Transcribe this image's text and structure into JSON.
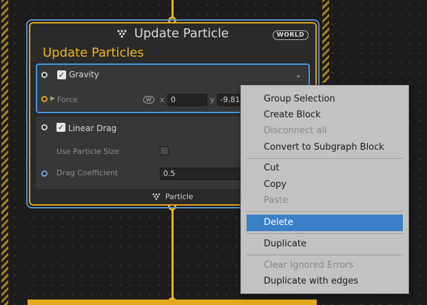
{
  "context": {
    "title": "Update Particle",
    "space_badge": "WORLD",
    "subtitle": "Update Particles",
    "footer_label": "Particle"
  },
  "blocks": {
    "gravity": {
      "label": "Gravity",
      "enabled": true,
      "force_label": "Force",
      "space_badge": "W",
      "x_label": "x",
      "x_value": "0",
      "y_label": "y",
      "y_value": "-9.81"
    },
    "linear_drag": {
      "label": "Linear Drag",
      "enabled": true,
      "use_particle_size_label": "Use Particle Size",
      "use_particle_size": false,
      "drag_coefficient_label": "Drag Coefficient",
      "drag_coefficient_value": "0.5"
    }
  },
  "context_menu": {
    "items": [
      {
        "label": "Group Selection",
        "enabled": true
      },
      {
        "label": "Create Block",
        "enabled": true
      },
      {
        "label": "Disconnect all",
        "enabled": false
      },
      {
        "label": "Convert to Subgraph Block",
        "enabled": true
      },
      {
        "label": "Cut",
        "enabled": true
      },
      {
        "label": "Copy",
        "enabled": true
      },
      {
        "label": "Paste",
        "enabled": false
      },
      {
        "label": "Delete",
        "enabled": true,
        "highlighted": true
      },
      {
        "label": "Duplicate",
        "enabled": true
      },
      {
        "label": "Clear Ignored Errors",
        "enabled": false
      },
      {
        "label": "Duplicate with edges",
        "enabled": true
      }
    ]
  },
  "colors": {
    "flow": "#f0b519",
    "selection": "#3f9ae6",
    "menu_highlight": "#3a7fc8"
  }
}
